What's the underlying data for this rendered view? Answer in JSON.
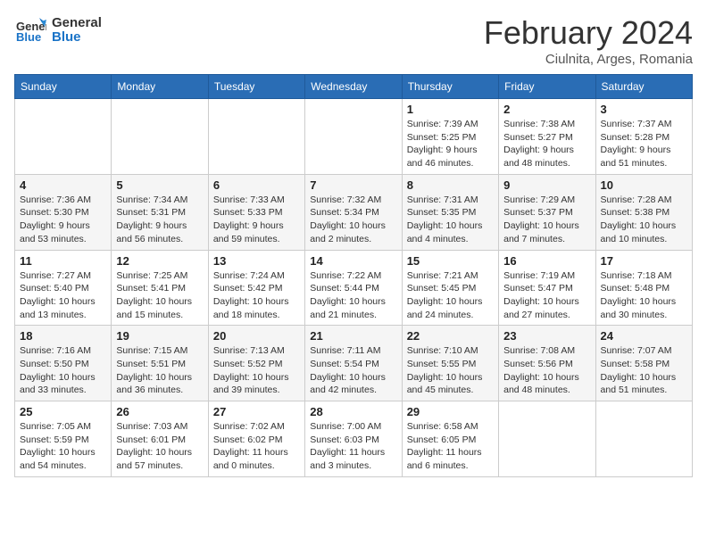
{
  "header": {
    "logo_general": "General",
    "logo_blue": "Blue",
    "month_year": "February 2024",
    "location": "Ciulnita, Arges, Romania"
  },
  "days_of_week": [
    "Sunday",
    "Monday",
    "Tuesday",
    "Wednesday",
    "Thursday",
    "Friday",
    "Saturday"
  ],
  "weeks": [
    [
      {
        "day": "",
        "info": ""
      },
      {
        "day": "",
        "info": ""
      },
      {
        "day": "",
        "info": ""
      },
      {
        "day": "",
        "info": ""
      },
      {
        "day": "1",
        "info": "Sunrise: 7:39 AM\nSunset: 5:25 PM\nDaylight: 9 hours\nand 46 minutes."
      },
      {
        "day": "2",
        "info": "Sunrise: 7:38 AM\nSunset: 5:27 PM\nDaylight: 9 hours\nand 48 minutes."
      },
      {
        "day": "3",
        "info": "Sunrise: 7:37 AM\nSunset: 5:28 PM\nDaylight: 9 hours\nand 51 minutes."
      }
    ],
    [
      {
        "day": "4",
        "info": "Sunrise: 7:36 AM\nSunset: 5:30 PM\nDaylight: 9 hours\nand 53 minutes."
      },
      {
        "day": "5",
        "info": "Sunrise: 7:34 AM\nSunset: 5:31 PM\nDaylight: 9 hours\nand 56 minutes."
      },
      {
        "day": "6",
        "info": "Sunrise: 7:33 AM\nSunset: 5:33 PM\nDaylight: 9 hours\nand 59 minutes."
      },
      {
        "day": "7",
        "info": "Sunrise: 7:32 AM\nSunset: 5:34 PM\nDaylight: 10 hours\nand 2 minutes."
      },
      {
        "day": "8",
        "info": "Sunrise: 7:31 AM\nSunset: 5:35 PM\nDaylight: 10 hours\nand 4 minutes."
      },
      {
        "day": "9",
        "info": "Sunrise: 7:29 AM\nSunset: 5:37 PM\nDaylight: 10 hours\nand 7 minutes."
      },
      {
        "day": "10",
        "info": "Sunrise: 7:28 AM\nSunset: 5:38 PM\nDaylight: 10 hours\nand 10 minutes."
      }
    ],
    [
      {
        "day": "11",
        "info": "Sunrise: 7:27 AM\nSunset: 5:40 PM\nDaylight: 10 hours\nand 13 minutes."
      },
      {
        "day": "12",
        "info": "Sunrise: 7:25 AM\nSunset: 5:41 PM\nDaylight: 10 hours\nand 15 minutes."
      },
      {
        "day": "13",
        "info": "Sunrise: 7:24 AM\nSunset: 5:42 PM\nDaylight: 10 hours\nand 18 minutes."
      },
      {
        "day": "14",
        "info": "Sunrise: 7:22 AM\nSunset: 5:44 PM\nDaylight: 10 hours\nand 21 minutes."
      },
      {
        "day": "15",
        "info": "Sunrise: 7:21 AM\nSunset: 5:45 PM\nDaylight: 10 hours\nand 24 minutes."
      },
      {
        "day": "16",
        "info": "Sunrise: 7:19 AM\nSunset: 5:47 PM\nDaylight: 10 hours\nand 27 minutes."
      },
      {
        "day": "17",
        "info": "Sunrise: 7:18 AM\nSunset: 5:48 PM\nDaylight: 10 hours\nand 30 minutes."
      }
    ],
    [
      {
        "day": "18",
        "info": "Sunrise: 7:16 AM\nSunset: 5:50 PM\nDaylight: 10 hours\nand 33 minutes."
      },
      {
        "day": "19",
        "info": "Sunrise: 7:15 AM\nSunset: 5:51 PM\nDaylight: 10 hours\nand 36 minutes."
      },
      {
        "day": "20",
        "info": "Sunrise: 7:13 AM\nSunset: 5:52 PM\nDaylight: 10 hours\nand 39 minutes."
      },
      {
        "day": "21",
        "info": "Sunrise: 7:11 AM\nSunset: 5:54 PM\nDaylight: 10 hours\nand 42 minutes."
      },
      {
        "day": "22",
        "info": "Sunrise: 7:10 AM\nSunset: 5:55 PM\nDaylight: 10 hours\nand 45 minutes."
      },
      {
        "day": "23",
        "info": "Sunrise: 7:08 AM\nSunset: 5:56 PM\nDaylight: 10 hours\nand 48 minutes."
      },
      {
        "day": "24",
        "info": "Sunrise: 7:07 AM\nSunset: 5:58 PM\nDaylight: 10 hours\nand 51 minutes."
      }
    ],
    [
      {
        "day": "25",
        "info": "Sunrise: 7:05 AM\nSunset: 5:59 PM\nDaylight: 10 hours\nand 54 minutes."
      },
      {
        "day": "26",
        "info": "Sunrise: 7:03 AM\nSunset: 6:01 PM\nDaylight: 10 hours\nand 57 minutes."
      },
      {
        "day": "27",
        "info": "Sunrise: 7:02 AM\nSunset: 6:02 PM\nDaylight: 11 hours\nand 0 minutes."
      },
      {
        "day": "28",
        "info": "Sunrise: 7:00 AM\nSunset: 6:03 PM\nDaylight: 11 hours\nand 3 minutes."
      },
      {
        "day": "29",
        "info": "Sunrise: 6:58 AM\nSunset: 6:05 PM\nDaylight: 11 hours\nand 6 minutes."
      },
      {
        "day": "",
        "info": ""
      },
      {
        "day": "",
        "info": ""
      }
    ]
  ]
}
